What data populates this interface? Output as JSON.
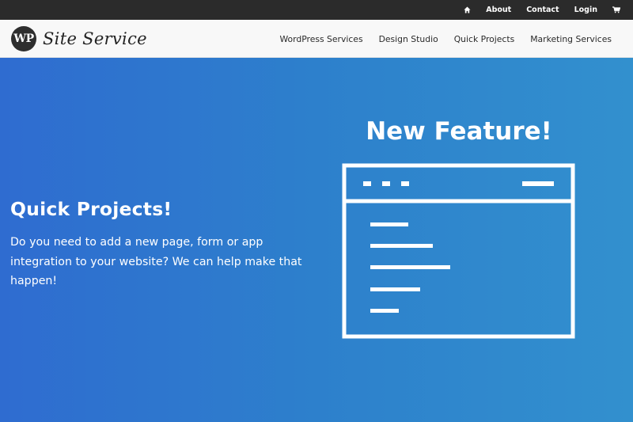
{
  "topbar": {
    "home_icon": "home-icon",
    "about": "About",
    "contact": "Contact",
    "login": "Login",
    "cart_icon": "cart-icon",
    "bg_color": "#2b2b2b"
  },
  "header": {
    "logo_badge": "WP",
    "logo_text": "Site Service",
    "nav": [
      "WordPress Services",
      "Design Studio",
      "Quick Projects",
      "Marketing Services"
    ]
  },
  "hero": {
    "title": "Quick Projects!",
    "description": "Do you need to add a new page, form or app integration to your website? We can help make that happen!",
    "feature_title": "New Feature!",
    "illustration_icon": "browser-window-icon",
    "gradient_start": "#2f6cd0",
    "gradient_end": "#3290ce"
  }
}
